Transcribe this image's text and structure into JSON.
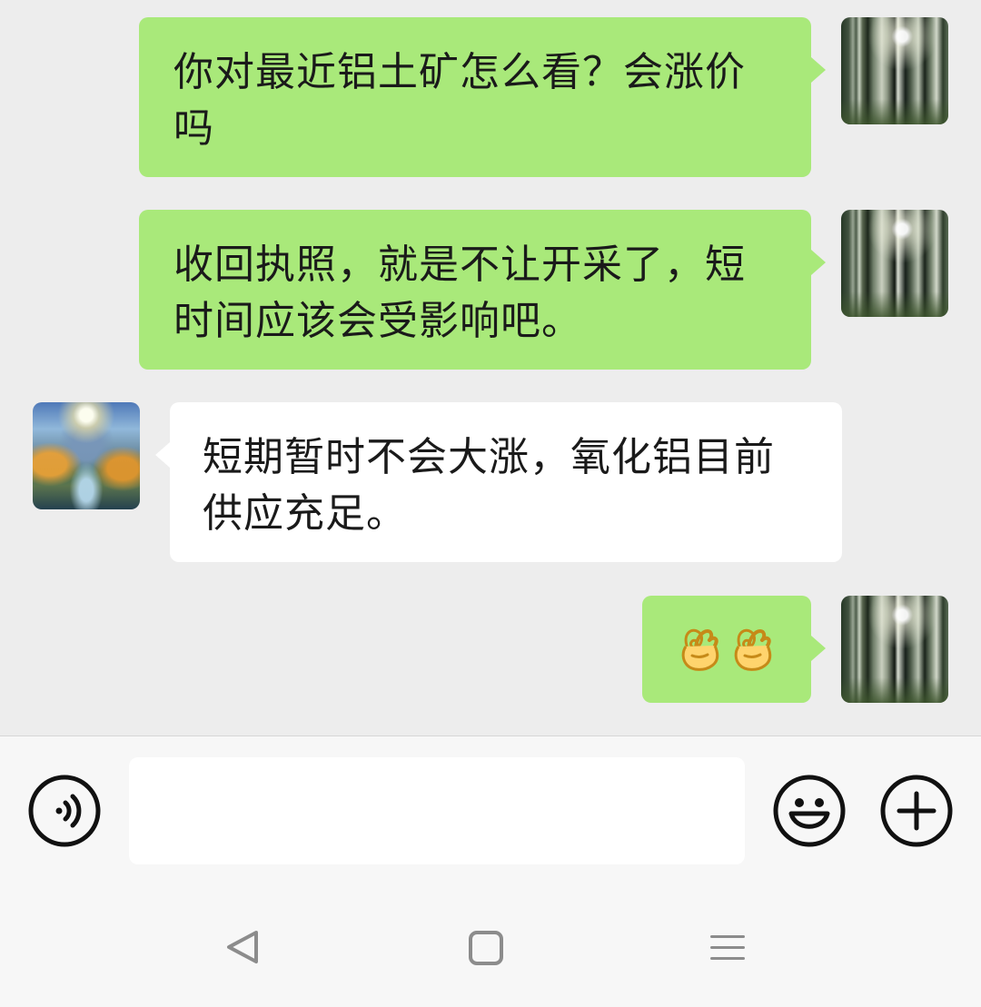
{
  "chat": {
    "messages": [
      {
        "direction": "sent",
        "text": "你对最近铝土矿怎么看？会涨价\n吗",
        "avatar": "self-avatar-forest-sunlight"
      },
      {
        "direction": "sent",
        "text": "收回执照，就是不让开采了，短\n时间应该会受影响吧。",
        "avatar": "self-avatar-forest-sunlight"
      },
      {
        "direction": "received",
        "text": "短期暂时不会大涨，氧化铝目前\n供应充足。",
        "avatar": "contact-avatar-waterfall-landscape"
      },
      {
        "direction": "sent",
        "text": "",
        "emoji": [
          "ok-hand",
          "ok-hand"
        ],
        "avatar": "self-avatar-forest-sunlight"
      }
    ]
  },
  "input_bar": {
    "message_value": "",
    "voice_icon": "voice-icon",
    "emoji_icon": "emoji-icon",
    "plus_icon": "plus-icon"
  },
  "navigation": {
    "back_icon": "back-triangle-icon",
    "home_icon": "home-square-icon",
    "menu_icon": "menu-lines-icon"
  },
  "colors": {
    "chat_background": "#ededed",
    "sent_bubble": "#a9e97a",
    "received_bubble": "#ffffff",
    "input_bar_background": "#f7f7f7",
    "icon_stroke": "#111111",
    "nav_icon": "#8c8c8c"
  }
}
